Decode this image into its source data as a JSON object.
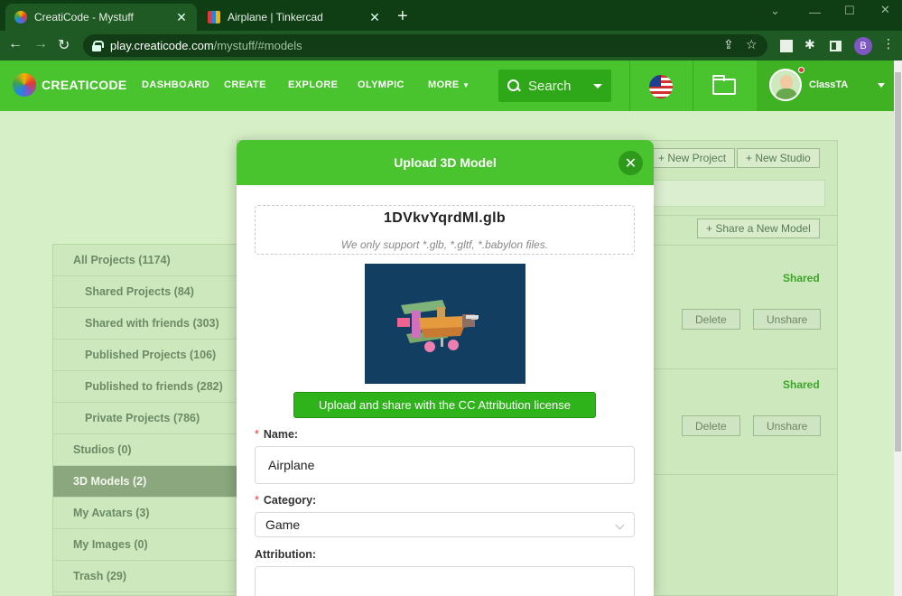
{
  "browser": {
    "tabs": [
      {
        "title": "CreatiCode - Mystuff",
        "active": true
      },
      {
        "title": "Airplane | Tinkercad",
        "active": false
      }
    ],
    "url_host": "play.creaticode.com",
    "url_path": "/mystuff/#models",
    "profile_initial": "B"
  },
  "header": {
    "logo_text": "CREATICODE",
    "nav": [
      "DASHBOARD",
      "CREATE",
      "EXPLORE",
      "OLYMPIC",
      "MORE"
    ],
    "search_placeholder": "Search",
    "username": "ClassTA"
  },
  "page": {
    "buttons": {
      "new_project": "+ New Project",
      "new_studio": "+ New Studio",
      "share_model": "+ Share a New Model"
    },
    "items": [
      {
        "status": "Shared",
        "delete_label": "Delete",
        "unshare_label": "Unshare"
      },
      {
        "status": "Shared",
        "delete_label": "Delete",
        "unshare_label": "Unshare"
      }
    ]
  },
  "sidebar": {
    "items": [
      {
        "label": "All Projects (1174)",
        "level": "top",
        "selected": false
      },
      {
        "label": "Shared Projects (84)",
        "level": "sub",
        "selected": false
      },
      {
        "label": "Shared with friends (303)",
        "level": "sub",
        "selected": false
      },
      {
        "label": "Published Projects (106)",
        "level": "sub",
        "selected": false
      },
      {
        "label": "Published to friends (282)",
        "level": "sub",
        "selected": false
      },
      {
        "label": "Private Projects (786)",
        "level": "sub",
        "selected": false
      },
      {
        "label": "Studios (0)",
        "level": "top",
        "selected": false
      },
      {
        "label": "3D Models (2)",
        "level": "top",
        "selected": true
      },
      {
        "label": "My Avatars (3)",
        "level": "top",
        "selected": false
      },
      {
        "label": "My Images (0)",
        "level": "top",
        "selected": false
      },
      {
        "label": "Trash (29)",
        "level": "top",
        "selected": false
      }
    ]
  },
  "modal": {
    "title": "Upload 3D Model",
    "file_name": "1DVkvYqrdMl.glb",
    "hint": "We only support *.glb, *.gltf, *.babylon files.",
    "upload_button": "Upload and share with the CC Attribution license",
    "name_label": "Name:",
    "name_value": "Airplane",
    "category_label": "Category:",
    "category_value": "Game",
    "attribution_label": "Attribution:",
    "attribution_value": ""
  },
  "colors": {
    "brand_green": "#49c32e",
    "button_green": "#2fb31b",
    "preview_bg": "#123e62"
  }
}
